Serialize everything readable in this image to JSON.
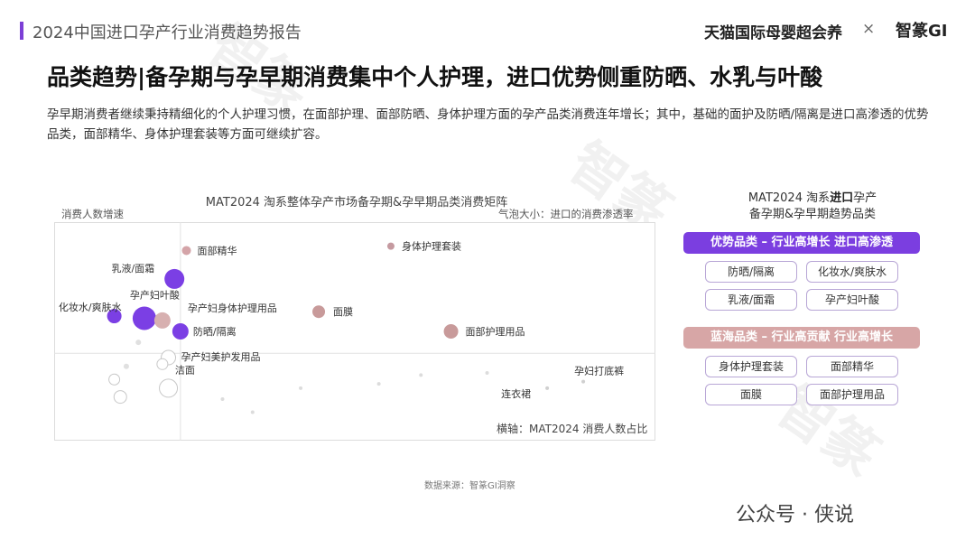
{
  "header": {
    "report_title": "2024中国进口孕产行业消费趋势报告",
    "brand_left": "天猫国际母婴超会养",
    "brand_sep": "×",
    "brand_right": "智篆GI"
  },
  "main_title": "品类趋势|备孕期与孕早期消费集中个人护理，进口优势侧重防晒、水乳与叶酸",
  "description": "孕早期消费者继续秉持精细化的个人护理习惯，在面部护理、面部防晒、身体护理方面的孕产品类消费连年增长；其中，基础的面护及防晒/隔离是进口高渗透的优势品类，面部精华、身体护理套装等方面可继续扩容。",
  "chart": {
    "title": "MAT2024 淘系整体孕产市场备孕期&孕早期品类消费矩阵",
    "y_label": "消费人数增速",
    "bubble_note": "气泡大小：进口的消费渗透率",
    "x_label": "横轴：MAT2024 消费人数占比"
  },
  "chart_data": {
    "type": "scatter",
    "title": "MAT2024 淘系整体孕产市场备孕期&孕早期品类消费矩阵",
    "xlabel": "横轴：MAT2024 消费人数占比",
    "ylabel": "消费人数增速",
    "size_label": "气泡大小：进口的消费渗透率",
    "xlim": [
      0,
      100
    ],
    "ylim": [
      0,
      100
    ],
    "quadrant_lines": {
      "x": 21,
      "y": 40
    },
    "points": [
      {
        "label": "面部精华",
        "x": 22,
        "y": 87,
        "size": 5,
        "color": "#d4a4a8"
      },
      {
        "label": "身体护理套装",
        "x": 56,
        "y": 89,
        "size": 4,
        "color": "#c59aa0"
      },
      {
        "label": "乳液/面霜",
        "x": 20,
        "y": 74,
        "size": 11,
        "color": "#7b3fe4"
      },
      {
        "label": "孕产妇叶酸",
        "x": 15,
        "y": 56,
        "size": 13,
        "color": "#7b3fe4"
      },
      {
        "label": "化妆水/爽肤水",
        "x": 10,
        "y": 57,
        "size": 8,
        "color": "#7b3fe4"
      },
      {
        "label": "孕产妇身体护理用品",
        "x": 18,
        "y": 55,
        "size": 9,
        "color": "#d7b0b0"
      },
      {
        "label": "防晒/隔离",
        "x": 21,
        "y": 50,
        "size": 9,
        "color": "#7b3fe4"
      },
      {
        "label": "面膜",
        "x": 44,
        "y": 59,
        "size": 7,
        "color": "#c89a9a"
      },
      {
        "label": "面部护理用品",
        "x": 66,
        "y": 50,
        "size": 8,
        "color": "#c89a9a"
      },
      {
        "label": "孕产妇美护发用品",
        "x": 19,
        "y": 38,
        "size": 8,
        "color": "#e8e8e8"
      },
      {
        "label": "洁面",
        "x": 18,
        "y": 35,
        "size": 6,
        "color": "#e8e8e8"
      },
      {
        "label": "连衣裙",
        "x": 82,
        "y": 24,
        "size": 2,
        "color": "#d0d0d0"
      },
      {
        "label": "孕妇打底裤",
        "x": 88,
        "y": 27,
        "size": 2,
        "color": "#d0d0d0"
      },
      {
        "label": "",
        "x": 19,
        "y": 24,
        "size": 10,
        "color": "#e8e8e8"
      },
      {
        "label": "",
        "x": 10,
        "y": 28,
        "size": 6,
        "color": "#e8e8e8"
      },
      {
        "label": "",
        "x": 11,
        "y": 20,
        "size": 7,
        "color": "#e8e8e8"
      },
      {
        "label": "",
        "x": 12,
        "y": 34,
        "size": 3,
        "color": "#e0e0e0"
      },
      {
        "label": "",
        "x": 14,
        "y": 45,
        "size": 3,
        "color": "#e0e0e0"
      },
      {
        "label": "",
        "x": 28,
        "y": 19,
        "size": 2,
        "color": "#dcdcdc"
      },
      {
        "label": "",
        "x": 33,
        "y": 13,
        "size": 2,
        "color": "#dcdcdc"
      },
      {
        "label": "",
        "x": 41,
        "y": 24,
        "size": 2,
        "color": "#dcdcdc"
      },
      {
        "label": "",
        "x": 54,
        "y": 26,
        "size": 2,
        "color": "#dcdcdc"
      },
      {
        "label": "",
        "x": 61,
        "y": 30,
        "size": 2,
        "color": "#dcdcdc"
      },
      {
        "label": "",
        "x": 72,
        "y": 31,
        "size": 2,
        "color": "#dcdcdc"
      }
    ]
  },
  "side_panel": {
    "title_line1_pre": "MAT2024 淘系",
    "title_line1_bold": "进口",
    "title_line1_post": "孕产",
    "title_line2": "备孕期&孕早期趋势品类",
    "advantage": {
      "label": "优势品类 – 行业高增长 进口高渗透",
      "items": [
        "防晒/隔离",
        "化妆水/爽肤水",
        "乳液/面霜",
        "孕产妇叶酸"
      ]
    },
    "blue_ocean": {
      "label": "蓝海品类 – 行业高贡献 行业高增长",
      "items": [
        "身体护理套装",
        "面部精华",
        "面膜",
        "面部护理用品"
      ]
    }
  },
  "source": "数据来源：智篆GI洞察",
  "footer_mark": "公众号 · 侠说",
  "colors": {
    "accent": "#7b3ee0",
    "blue_ocean": "#d7a6a6"
  }
}
